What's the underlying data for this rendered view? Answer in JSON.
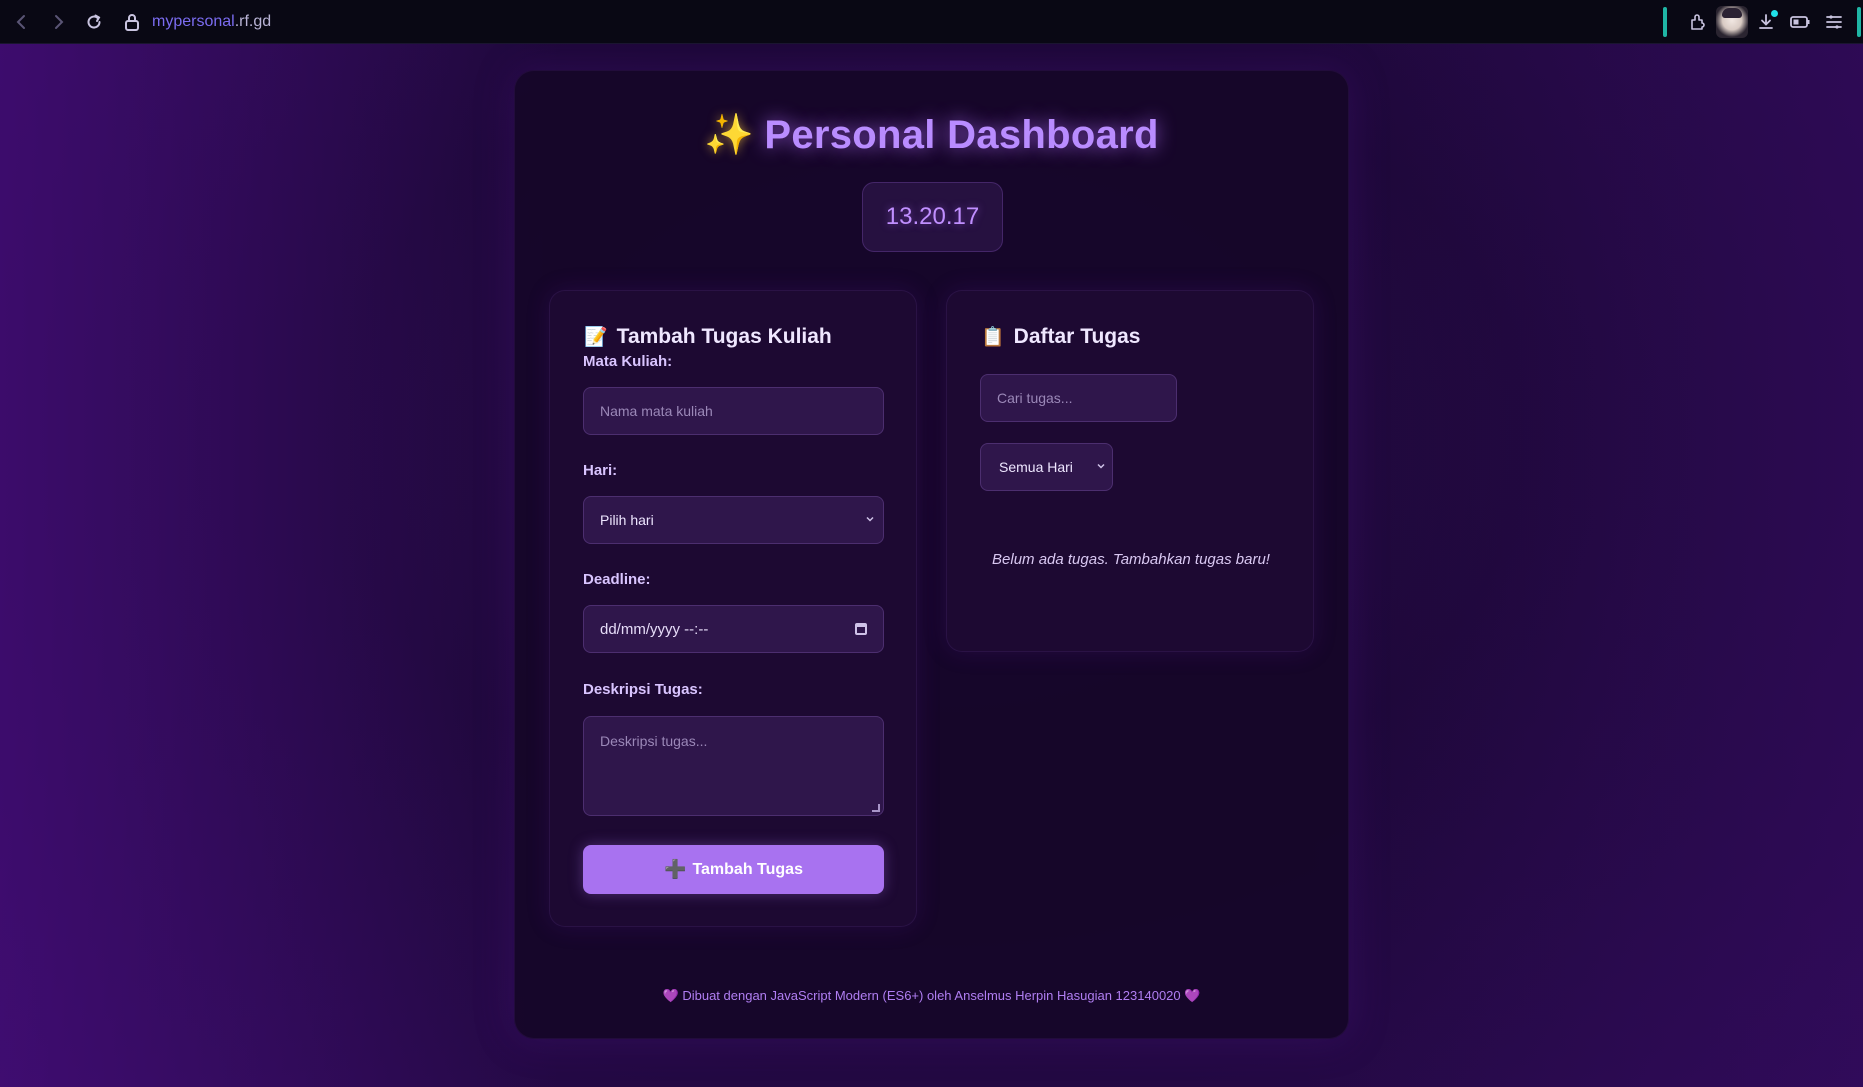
{
  "browser": {
    "url_main": "mypersonal",
    "url_rest": ".rf.gd"
  },
  "page": {
    "title": "Personal Dashboard",
    "title_icon": "✨",
    "clock": "13.20.17"
  },
  "form": {
    "title": "Tambah Tugas Kuliah",
    "title_icon": "📝",
    "course_label": "Mata Kuliah:",
    "course_placeholder": "Nama mata kuliah",
    "day_label": "Hari:",
    "day_value": "Pilih hari",
    "deadline_label": "Deadline:",
    "deadline_value": "dd/mm/yyyy --:--",
    "desc_label": "Deskripsi Tugas:",
    "desc_placeholder": "Deskripsi tugas...",
    "add_button": "Tambah Tugas",
    "add_icon": "➕"
  },
  "tasks": {
    "title": "Daftar Tugas",
    "title_icon": "📋",
    "search_placeholder": "Cari tugas...",
    "filter_value": "Semua Hari",
    "empty_message": "Belum ada tugas. Tambahkan tugas baru!"
  },
  "footer": {
    "text": "Dibuat dengan JavaScript Modern (ES6+) oleh Anselmus Herpin Hasugian 123140020",
    "heart": "💜"
  },
  "colors": {
    "accent": "#a872f0",
    "title_glow": "#b98cff",
    "background": "#1d0838",
    "teal": "#1fb5a5"
  }
}
